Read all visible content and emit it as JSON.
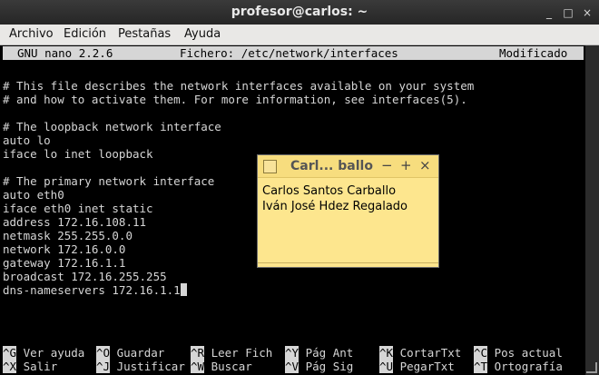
{
  "window": {
    "title": "profesor@carlos: ~"
  },
  "menu": [
    "Archivo",
    "Edición",
    "Pestañas",
    "Ayuda"
  ],
  "nano": {
    "version": "GNU nano 2.2.6",
    "file": "Fichero: /etc/network/interfaces",
    "status": "Modificado",
    "lines": [
      "",
      "# This file describes the network interfaces available on your system",
      "# and how to activate them. For more information, see interfaces(5).",
      "",
      "# The loopback network interface",
      "auto lo",
      "iface lo inet loopback",
      "",
      "# The primary network interface",
      "auto eth0",
      "iface eth0 inet static",
      "address 172.16.108.11",
      "netmask 255.255.0.0",
      "network 172.16.0.0",
      "gateway 172.16.1.1",
      "broadcast 172.16.255.255",
      "dns-nameservers 172.16.1.1"
    ],
    "shortcuts_row1": [
      {
        "key": "^G",
        "label": "Ver ayuda"
      },
      {
        "key": "^O",
        "label": "Guardar"
      },
      {
        "key": "^R",
        "label": "Leer Fich"
      },
      {
        "key": "^Y",
        "label": "Pág Ant"
      },
      {
        "key": "^K",
        "label": "CortarTxt"
      },
      {
        "key": "^C",
        "label": "Pos actual"
      }
    ],
    "shortcuts_row2": [
      {
        "key": "^X",
        "label": "Salir"
      },
      {
        "key": "^J",
        "label": "Justificar"
      },
      {
        "key": "^W",
        "label": "Buscar"
      },
      {
        "key": "^V",
        "label": "Pág Sig"
      },
      {
        "key": "^U",
        "label": "PegarTxt"
      },
      {
        "key": "^T",
        "label": "Ortografía"
      }
    ]
  },
  "note": {
    "title": "Carl... ballo",
    "btn_min": "−",
    "btn_add": "+",
    "btn_close": "×",
    "text": "Carlos Santos Carballo\nIván José Hdez Regalado"
  },
  "icons": {
    "minimize": "minimize-icon",
    "maximize": "maximize-icon",
    "close": "close-icon",
    "note": "note-icon"
  }
}
